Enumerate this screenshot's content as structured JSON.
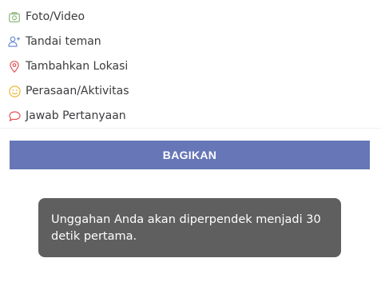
{
  "options": [
    {
      "label": "Foto/Video",
      "icon": "photo-icon",
      "color": "#8bb67b"
    },
    {
      "label": "Tandai teman",
      "icon": "tag-friend-icon",
      "color": "#6d8ed4"
    },
    {
      "label": "Tambahkan Lokasi",
      "icon": "location-pin-icon",
      "color": "#e0545a"
    },
    {
      "label": "Perasaan/Aktivitas",
      "icon": "smiley-icon",
      "color": "#eab936"
    },
    {
      "label": "Jawab Pertanyaan",
      "icon": "question-bubble-icon",
      "color": "#e0545a"
    }
  ],
  "share_button": {
    "label": "BAGIKAN",
    "color": "#6676b7"
  },
  "toast": {
    "message": "Unggahan Anda akan diperpendek menjadi 30 detik pertama."
  }
}
